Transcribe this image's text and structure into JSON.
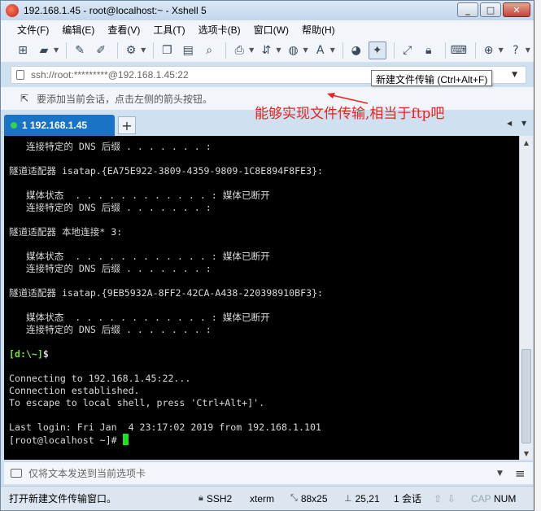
{
  "window": {
    "title": "192.168.1.45 - root@localhost:~ - Xshell 5"
  },
  "menu": [
    {
      "label": "文件(F)"
    },
    {
      "label": "编辑(E)"
    },
    {
      "label": "查看(V)"
    },
    {
      "label": "工具(T)"
    },
    {
      "label": "选项卡(B)"
    },
    {
      "label": "窗口(W)"
    },
    {
      "label": "帮助(H)"
    }
  ],
  "address": {
    "value": "ssh://root:*********@192.168.1.45:22"
  },
  "tooltip": {
    "text": "新建文件传输 (Ctrl+Alt+F)"
  },
  "hint": {
    "text": "要添加当前会话，点击左侧的箭头按钮。"
  },
  "annotation": {
    "text": "能够实现文件传输,相当于ftp吧",
    "color": "#e8221e"
  },
  "tab": {
    "label": "1 192.168.1.45",
    "status_color": "#35d24a"
  },
  "terminal": {
    "lines": [
      "   连接特定的 DNS 后缀 . . . . . . . :",
      "",
      "隧道适配器 isatap.{EA75E922-3809-4359-9809-1C8E894F8FE3}:",
      "",
      "   媒体状态  . . . . . . . . . . . . : 媒体已断开",
      "   连接特定的 DNS 后缀 . . . . . . . :",
      "",
      "隧道适配器 本地连接* 3:",
      "",
      "   媒体状态  . . . . . . . . . . . . : 媒体已断开",
      "   连接特定的 DNS 后缀 . . . . . . . :",
      "",
      "隧道适配器 isatap.{9EB5932A-8FF2-42CA-A438-220398910BF3}:",
      "",
      "   媒体状态  . . . . . . . . . . . . : 媒体已断开",
      "   连接特定的 DNS 后缀 . . . . . . . :",
      "",
      "[d:\\~]$",
      "",
      "Connecting to 192.168.1.45:22...",
      "Connection established.",
      "To escape to local shell, press 'Ctrl+Alt+]'.",
      "",
      "Last login: Fri Jan  4 23:17:02 2019 from 192.168.1.101"
    ],
    "prompt": "[root@localhost ~]# "
  },
  "sendbar": {
    "placeholder": "仅将文本发送到当前选项卡"
  },
  "status": {
    "message": "打开新建文件传输窗口。",
    "protocol": "SSH2",
    "terminal_type": "xterm",
    "size": "88x25",
    "position": "25,21",
    "sessions": "1 会话",
    "caps": "CAP",
    "num": "NUM"
  }
}
